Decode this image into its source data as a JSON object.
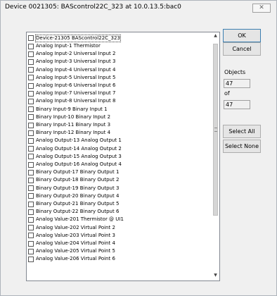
{
  "window": {
    "title": "Device 0021305:  BAScontrol22C_323 at 10.0.13.5:bac0",
    "close_glyph": "✕"
  },
  "objects": {
    "items": [
      {
        "label": "Device-21305 BAScontrol22C_323",
        "checked": false
      },
      {
        "label": "Analog Input-1 Thermistor",
        "checked": false
      },
      {
        "label": "Analog Input-2 Universal Input 2",
        "checked": false
      },
      {
        "label": "Analog Input-3 Universal Input 3",
        "checked": false
      },
      {
        "label": "Analog Input-4 Universal Input 4",
        "checked": false
      },
      {
        "label": "Analog Input-5 Universal Input 5",
        "checked": false
      },
      {
        "label": "Analog Input-6 Universal Input 6",
        "checked": false
      },
      {
        "label": "Analog Input-7 Universal Input 7",
        "checked": false
      },
      {
        "label": "Analog Input-8 Universal Input 8",
        "checked": false
      },
      {
        "label": "Binary Input-9 Binary Input 1",
        "checked": false
      },
      {
        "label": "Binary Input-10 Binary Input 2",
        "checked": false
      },
      {
        "label": "Binary Input-11 Binary Input 3",
        "checked": false
      },
      {
        "label": "Binary Input-12 Binary Input 4",
        "checked": false
      },
      {
        "label": "Analog Output-13 Analog Output 1",
        "checked": false
      },
      {
        "label": "Analog Output-14 Analog Output 2",
        "checked": false
      },
      {
        "label": "Analog Output-15 Analog Output 3",
        "checked": false
      },
      {
        "label": "Analog Output-16 Analog Output 4",
        "checked": false
      },
      {
        "label": "Binary Output-17 Binary Output 1",
        "checked": false
      },
      {
        "label": "Binary Output-18 Binary Output 2",
        "checked": false
      },
      {
        "label": "Binary Output-19 Binary Output 3",
        "checked": false
      },
      {
        "label": "Binary Output-20 Binary Output 4",
        "checked": false
      },
      {
        "label": "Binary Output-21 Binary Output 5",
        "checked": false
      },
      {
        "label": "Binary Output-22 Binary Output 6",
        "checked": false
      },
      {
        "label": "Analog Value-201 Thermistor @ UI1",
        "checked": false
      },
      {
        "label": "Analog Value-202 Virtual Point 2",
        "checked": false
      },
      {
        "label": "Analog Value-203 Virtual Point 3",
        "checked": false
      },
      {
        "label": "Analog Value-204 Virtual Point 4",
        "checked": false
      },
      {
        "label": "Analog Value-205 Virtual Point 5",
        "checked": false
      },
      {
        "label": "Analog Value-206 Virtual Point 6",
        "checked": false
      }
    ],
    "scroll_up": "▲",
    "scroll_down": "▼"
  },
  "buttons": {
    "ok": "OK",
    "cancel": "Cancel",
    "select_all": "Select All",
    "select_none": "Select None"
  },
  "counts": {
    "objects_label": "Objects",
    "selected": "47",
    "of_label": "of",
    "total": "47"
  }
}
